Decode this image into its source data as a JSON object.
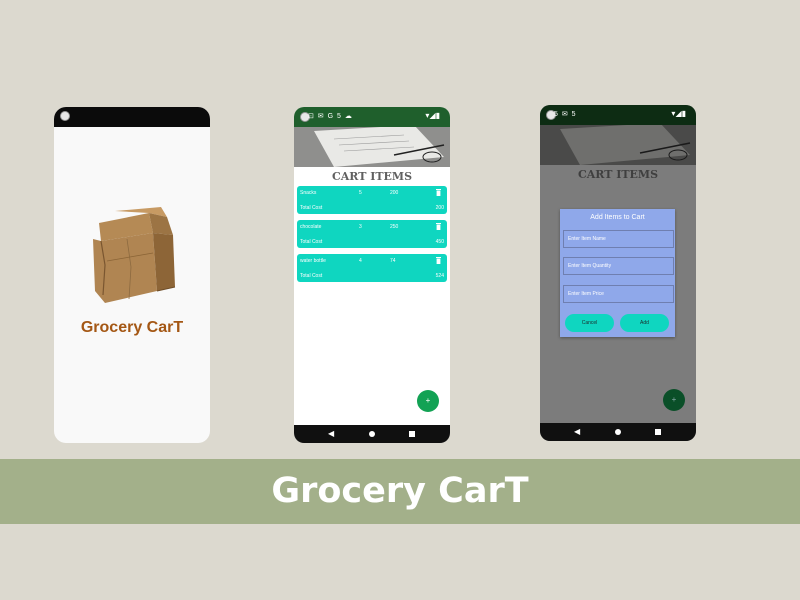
{
  "splash": {
    "app_name": "Grocery CarT",
    "icon": "paper-bag-icon"
  },
  "status_bar": {
    "left_icons_phone2": "⊡ ✉ G 5 ☁",
    "left_icons_phone3": "5 ✉ 5",
    "right_icons": "▾◢▮"
  },
  "cart": {
    "title": "CART ITEMS",
    "total_label": "Total Cost",
    "items": [
      {
        "name": "Snacks",
        "quantity": "5",
        "price": "200",
        "total": "200"
      },
      {
        "name": "chocolate",
        "quantity": "3",
        "price": "250",
        "total": "450"
      },
      {
        "name": "water bottle",
        "quantity": "4",
        "price": "74",
        "total": "524"
      }
    ],
    "fab_label": "+"
  },
  "dialog": {
    "title": "Add Items to Cart",
    "name_placeholder": "Enter Item Name",
    "quantity_placeholder": "Enter Item Quantity",
    "price_placeholder": "Enter Item Price",
    "cancel_label": "Cancel",
    "add_label": "Add"
  },
  "nav": {
    "back_glyph": "◀"
  },
  "banner": {
    "title": "Grocery CarT"
  },
  "colors": {
    "background": "#dcd9cf",
    "banner": "#a3b08a",
    "accent_teal": "#0fd6c0",
    "status_green": "#1f5f2c",
    "fab_green": "#12a254",
    "dialog_blue": "#8fa8ea",
    "brand_brown": "#a45714"
  }
}
